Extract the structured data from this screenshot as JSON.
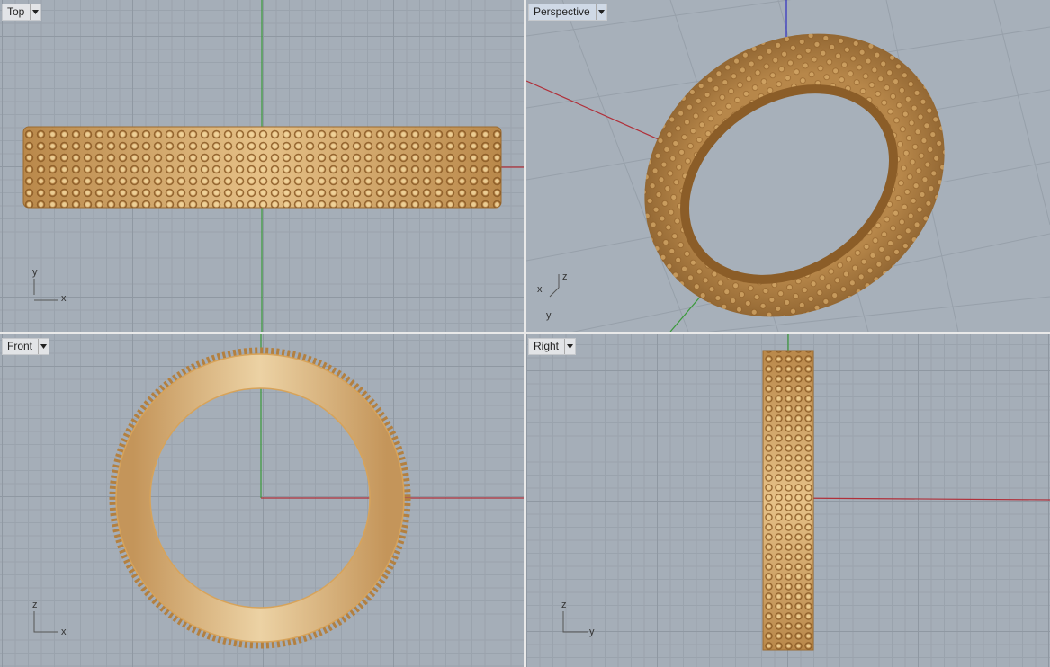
{
  "viewports": {
    "top": {
      "label": "Top",
      "axis_labels": [
        "y",
        "x"
      ]
    },
    "perspective": {
      "label": "Perspective",
      "axis_labels": [
        "z",
        "x",
        "y"
      ]
    },
    "front": {
      "label": "Front",
      "axis_labels": [
        "z",
        "x"
      ]
    },
    "right": {
      "label": "Right",
      "axis_labels": [
        "z",
        "y"
      ]
    }
  },
  "icons": {
    "viewport_menu": "dropdown-arrow-icon"
  },
  "colors": {
    "viewport_bg": "#a5aeb8",
    "grid": "#9aa3ad",
    "axis_x": "#b0303a",
    "axis_y": "#3a9a3a",
    "axis_z": "#3030c0",
    "ring_gold": "#c99a5a"
  }
}
